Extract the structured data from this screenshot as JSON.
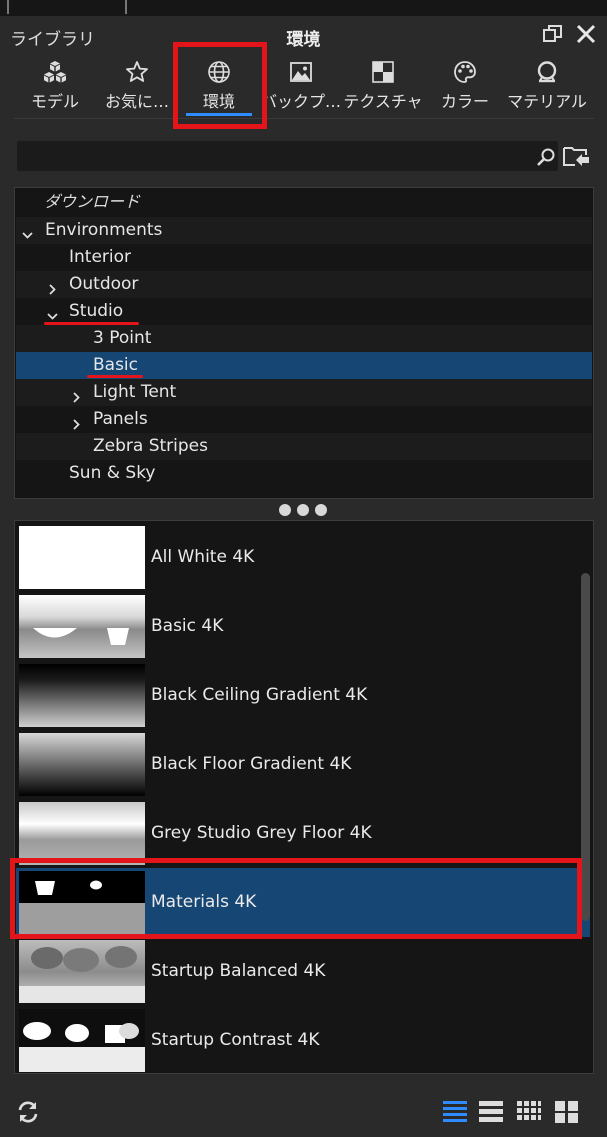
{
  "header": {
    "library_label": "ライブラリ",
    "title": "環境"
  },
  "tabs": [
    {
      "label": "モデル",
      "icon": "cubes-icon"
    },
    {
      "label": "お気に…",
      "icon": "star-icon"
    },
    {
      "label": "環境",
      "icon": "globe-icon",
      "active": true
    },
    {
      "label": "バックプ…",
      "icon": "image-icon"
    },
    {
      "label": "テクスチャ",
      "icon": "checker-icon"
    },
    {
      "label": "カラー",
      "icon": "palette-icon"
    },
    {
      "label": "マテリアル",
      "icon": "material-ball-icon"
    }
  ],
  "search": {
    "value": "",
    "placeholder": ""
  },
  "tree": {
    "download_label": "ダウンロード",
    "items": [
      {
        "label": "Environments",
        "state": "expanded"
      },
      {
        "label": "Interior"
      },
      {
        "label": "Outdoor",
        "state": "collapsed"
      },
      {
        "label": "Studio",
        "state": "expanded"
      },
      {
        "label": "3 Point"
      },
      {
        "label": "Basic",
        "selected": true
      },
      {
        "label": "Light Tent",
        "state": "collapsed"
      },
      {
        "label": "Panels",
        "state": "collapsed"
      },
      {
        "label": "Zebra Stripes"
      },
      {
        "label": "Sun & Sky"
      }
    ]
  },
  "environments": [
    {
      "label": "All White 4K"
    },
    {
      "label": "Basic 4K"
    },
    {
      "label": "Black Ceiling Gradient 4K"
    },
    {
      "label": "Black Floor Gradient 4K"
    },
    {
      "label": "Grey Studio Grey Floor 4K"
    },
    {
      "label": "Materials 4K",
      "selected": true
    },
    {
      "label": "Startup Balanced 4K"
    },
    {
      "label": "Startup Contrast 4K"
    }
  ],
  "colors": {
    "accent": "#2f8cff",
    "selection": "#164673",
    "annotation": "#e3151b",
    "panel": "#2a2a2a"
  },
  "bottom_bar": {
    "icons": [
      "refresh-icon",
      "list-view-icon",
      "compact-list-icon",
      "small-grid-icon",
      "large-grid-icon"
    ]
  }
}
